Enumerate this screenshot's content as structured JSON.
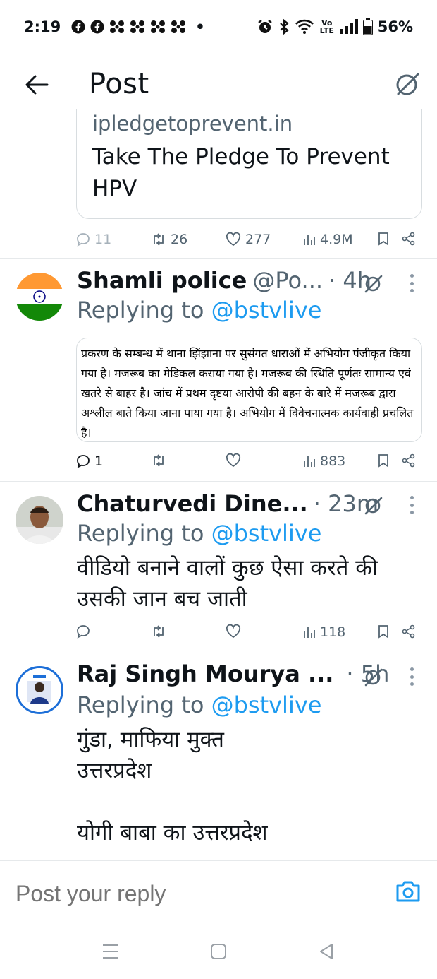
{
  "status_bar": {
    "time": "2:19",
    "dot": "•",
    "battery": "56%",
    "left_icons": [
      "facebook-icon",
      "facebook-icon",
      "app-grid-icon",
      "app-grid-icon",
      "app-grid-icon",
      "app-grid-icon"
    ],
    "right_icons": [
      "alarm-icon",
      "bluetooth-icon",
      "wifi-icon",
      "volte-icon",
      "signal-icon",
      "battery-icon"
    ],
    "volte_label": "Vo LTE"
  },
  "header": {
    "title": "Post"
  },
  "link_card": {
    "domain": "ipledgetoprevent.in",
    "title": "Take The Pledge To Prevent HPV"
  },
  "main_actions": {
    "replies": "11",
    "reposts": "26",
    "likes": "277",
    "views": "4.9M"
  },
  "replies": [
    {
      "name": "Shamli police",
      "handle": "@Po...",
      "time": "· 4h",
      "replying_prefix": "Replying to ",
      "replying_to": "@bstvlive",
      "image_text": "प्रकरण के सम्बन्ध में थाना झिंझाना पर सुसंगत धाराओं में अभियोग पंजीकृत किया गया है। मजरूब का मेडिकल कराया गया है। मजरूब की स्थिति पूर्णतः सामान्य एवं खतरे से बाहर है। जांच में प्रथम दृष्टया आरोपी की बहन के बारे में मजरूब द्वारा अश्लील बाते किया जाना पाया गया है। अभियोग में विवेचनात्मक कार्यवाही प्रचलित है।",
      "replies": "1",
      "reposts": "",
      "likes": "",
      "views": "883"
    },
    {
      "name": "Chaturvedi Dine...",
      "handle": "",
      "time": "· 23m",
      "replying_prefix": "Replying to ",
      "replying_to": "@bstvlive",
      "text": "वीडियो बनाने वालों कुछ ऐसा करते की\nउसकी जान बच जाती",
      "replies": "",
      "reposts": "",
      "likes": "",
      "views": "118"
    },
    {
      "name": "Raj Singh Mourya ...",
      "handle": "",
      "time": "· 5h",
      "replying_prefix": "Replying to ",
      "replying_to": "@bstvlive",
      "text": "गुंडा, माफिया मुक्त\nउत्तरप्रदेश\n\nयोगी बाबा का उत्तरप्रदेश"
    }
  ],
  "reply_bar": {
    "placeholder": "Post your reply"
  },
  "colors": {
    "link": "#1d9bf0",
    "secondary_text": "#536471",
    "primary_text": "#0f1419",
    "divider": "#e6e9eb"
  }
}
